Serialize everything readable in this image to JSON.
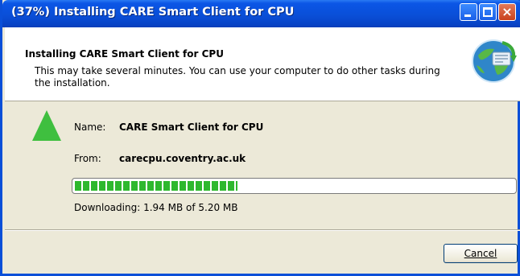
{
  "window": {
    "title": "(37%) Installing CARE Smart Client for CPU",
    "controls": {
      "minimize": "minimize",
      "maximize": "maximize",
      "close": "×"
    }
  },
  "header": {
    "title": "Installing CARE Smart Client for CPU",
    "description": "This may take several minutes. You can use your computer to do other tasks during the installation."
  },
  "details": {
    "name_label": "Name:",
    "name_value": "CARE Smart Client for CPU",
    "from_label": "From:",
    "from_value": "carecpu.coventry.ac.uk"
  },
  "progress": {
    "fraction": 0.37,
    "status": "Downloading: 1.94 MB of 5.20 MB"
  },
  "buttons": {
    "cancel": "Cancel"
  },
  "colors": {
    "titlebar": "#0a4fd8",
    "progress": "#2eb82e",
    "triangle": "#3fbf3f"
  },
  "icons": {
    "header": "globe-install-icon",
    "app": "green-triangle-icon"
  }
}
